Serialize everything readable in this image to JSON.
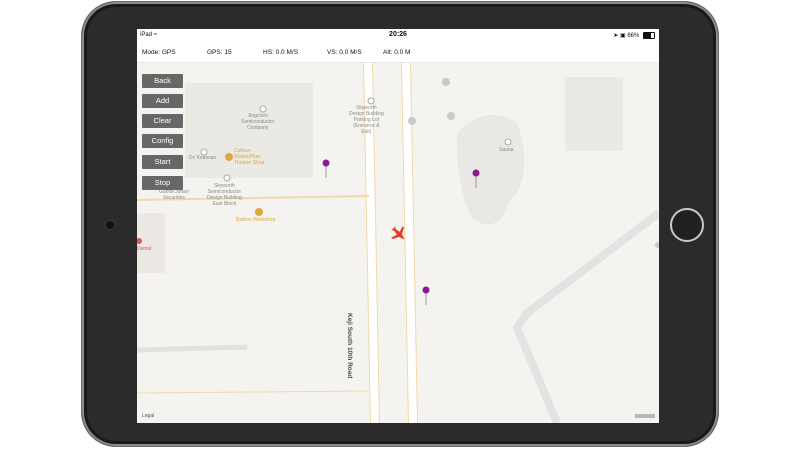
{
  "status_bar": {
    "device": "iPad",
    "wifi_icon": "wifi-icon",
    "time": "20:26",
    "battery": "66%"
  },
  "telemetry": {
    "mode": "Mode: GPS",
    "gps": "GPS:  15",
    "hs": "HS:  0.0 M/S",
    "vs": "VS:  0.0 M/S",
    "alt": "Alt:  0.0 M"
  },
  "controls": {
    "back": "Back",
    "add": "Add",
    "clear": "Clear",
    "config": "Config",
    "start": "Start",
    "stop": "Stop"
  },
  "map": {
    "pois": {
      "jingchen": "Jingchen\nSemiconductor\nCompany",
      "skyworth_parking": "Skyworth\nDesign Building\nParking Lot\n(Entrance &\nExit)",
      "dc_kebosan": "Dc Kebosan",
      "callsun": "Callsun\nStationPlum\nTheater Shop",
      "guotai": "Guotai Junan\nSecurities",
      "skyworth_east": "Skyworth\nSemiconductor\nDesign Building\nEast Block",
      "bathos": "Bathos Workshop",
      "sauna": "Sauna",
      "dental": "Dental"
    },
    "road_label": "Keji South 10th Road",
    "legal": "Legal"
  },
  "colors": {
    "map_background": "#f4f3ef",
    "road": "#ffffff",
    "road_edge": "#f1d9a8",
    "button": "#676767",
    "waypoint": "#8b1a8b",
    "aircraft": "#e23b2a"
  }
}
